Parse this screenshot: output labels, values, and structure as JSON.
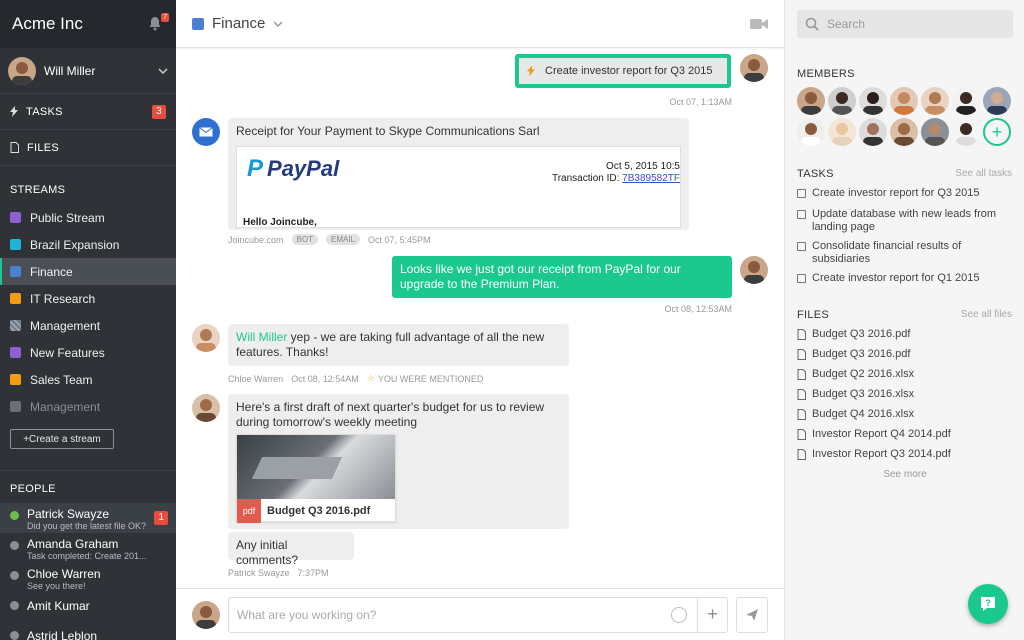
{
  "sidebar": {
    "brand": "Acme Inc",
    "notif_count": "7",
    "user_name": "Will Miller",
    "tasks_label": "TASKS",
    "tasks_count": "3",
    "files_label": "FILES",
    "streams_header": "STREAMS",
    "streams": [
      {
        "label": "Public Stream",
        "color": "#8e5fd6"
      },
      {
        "label": "Brazil Expansion",
        "color": "#1fb5d6"
      },
      {
        "label": "Finance",
        "color": "#4a7fd6"
      },
      {
        "label": "IT Research",
        "color": "#f39c12"
      },
      {
        "label": "Management",
        "color": "#6b7a8a"
      },
      {
        "label": "New Features",
        "color": "#8e5fd6"
      },
      {
        "label": "Sales Team",
        "color": "#f39c12"
      },
      {
        "label": "Management",
        "color": "#6b7075"
      }
    ],
    "create_stream": "+Create a stream",
    "people_header": "PEOPLE",
    "people": [
      {
        "name": "Patrick Swayze",
        "status": "Did you get the latest file OK?",
        "badge": "1"
      },
      {
        "name": "Amanda Graham",
        "status": "Task completed: Create 201..."
      },
      {
        "name": "Chloe Warren",
        "status": "See you there!"
      },
      {
        "name": "Amit Kumar",
        "status": ""
      },
      {
        "name": "Astrid Leblon",
        "status": ""
      }
    ]
  },
  "main": {
    "stream_name": "Finance",
    "messages": {
      "m1": {
        "task": "Create investor report for Q3 2015",
        "time": "Oct 07, 1:13AM"
      },
      "m2": {
        "title": "Receipt for Your Payment to Skype Communications Sarl",
        "paypal": "PayPal",
        "date": "Oct 5, 2015 10:5",
        "txn_label": "Transaction ID: ",
        "txn_id": "7B389582TF",
        "greeting": "Hello Joincube,",
        "sender": "Joincube.com",
        "tag1": "BOT",
        "tag2": "EMAIL",
        "time": "Oct 07, 5:45PM"
      },
      "m3": {
        "text": "Looks like we just got our receipt from PayPal for our upgrade to the Premium Plan.",
        "time": "Oct 08, 12:53AM"
      },
      "m4": {
        "mention": "Will Miller",
        "text": " yep - we are taking full advantage of all the new features. Thanks!",
        "sender": "Chloe Warren",
        "time": "Oct 08, 12:54AM",
        "mentioned": "YOU WERE MENTIONED"
      },
      "m5": {
        "text": "Here's a first draft of next quarter's budget for us to review during tomorrow's weekly meeting",
        "file_type": "pdf",
        "file_name": "Budget Q3 2016.pdf",
        "text2": "Any initial comments?",
        "sender": "Patrick Swayze",
        "time": "7:37PM"
      }
    },
    "composer_placeholder": "What are you working on?",
    "composer_plus": "+"
  },
  "right": {
    "search_placeholder": "Search",
    "members_header": "MEMBERS",
    "tasks_header": "TASKS",
    "see_all_tasks": "See all tasks",
    "tasks": [
      "Create investor report for Q3 2015",
      "Update database with new leads from landing page",
      "Consolidate financial results of subsidiaries",
      "Create investor report for Q1 2015"
    ],
    "files_header": "FILES",
    "see_all_files": "See all files",
    "files": [
      "Budget Q3 2016.pdf",
      "Budget Q3 2016.pdf",
      "Budget Q2 2016.xlsx",
      "Budget Q3 2016.xlsx",
      "Budget Q4 2016.xlsx",
      "Investor Report Q4 2014.pdf",
      "Investor Report Q3 2014.pdf"
    ],
    "see_more": "See more"
  }
}
